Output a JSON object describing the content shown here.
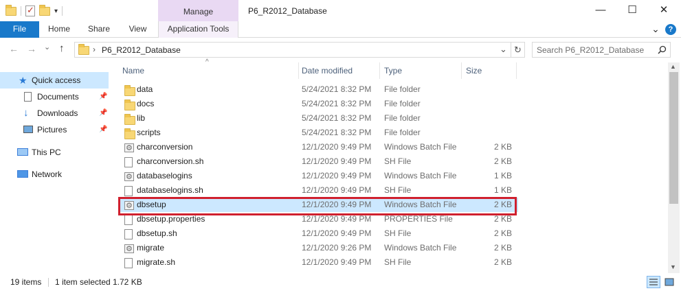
{
  "window": {
    "title": "P6_R2012_Database",
    "minimize": "—",
    "maximize": "☐",
    "close": "✕"
  },
  "ribbon": {
    "context_label": "Manage",
    "tabs": [
      "File",
      "Home",
      "Share",
      "View",
      "Application Tools"
    ],
    "collapse": "⌄",
    "help": "?"
  },
  "address": {
    "back": "←",
    "forward": "→",
    "history": "⌄",
    "up": "↑",
    "separator": "›",
    "path": "P6_R2012_Database",
    "dropdown": "⌄",
    "refresh": "↻"
  },
  "search": {
    "placeholder": "Search P6_R2012_Database",
    "icon": "search-icon"
  },
  "nav": {
    "quick_access": "Quick access",
    "documents": "Documents",
    "downloads": "Downloads",
    "pictures": "Pictures",
    "this_pc": "This PC",
    "network": "Network",
    "pin": "📌"
  },
  "columns": {
    "name": "Name",
    "date": "Date modified",
    "type": "Type",
    "size": "Size",
    "sort_indicator": "^"
  },
  "files": [
    {
      "name": "data",
      "date": "5/24/2021 8:32 PM",
      "type": "File folder",
      "size": "",
      "icon": "folder-icon"
    },
    {
      "name": "docs",
      "date": "5/24/2021 8:32 PM",
      "type": "File folder",
      "size": "",
      "icon": "folder-icon"
    },
    {
      "name": "lib",
      "date": "5/24/2021 8:32 PM",
      "type": "File folder",
      "size": "",
      "icon": "folder-icon"
    },
    {
      "name": "scripts",
      "date": "5/24/2021 8:32 PM",
      "type": "File folder",
      "size": "",
      "icon": "folder-icon"
    },
    {
      "name": "charconversion",
      "date": "12/1/2020 9:49 PM",
      "type": "Windows Batch File",
      "size": "2 KB",
      "icon": "batch-file-icon"
    },
    {
      "name": "charconversion.sh",
      "date": "12/1/2020 9:49 PM",
      "type": "SH File",
      "size": "2 KB",
      "icon": "file-icon"
    },
    {
      "name": "databaselogins",
      "date": "12/1/2020 9:49 PM",
      "type": "Windows Batch File",
      "size": "1 KB",
      "icon": "batch-file-icon"
    },
    {
      "name": "databaselogins.sh",
      "date": "12/1/2020 9:49 PM",
      "type": "SH File",
      "size": "1 KB",
      "icon": "file-icon"
    },
    {
      "name": "dbsetup",
      "date": "12/1/2020 9:49 PM",
      "type": "Windows Batch File",
      "size": "2 KB",
      "icon": "batch-file-icon",
      "selected": true
    },
    {
      "name": "dbsetup.properties",
      "date": "12/1/2020 9:49 PM",
      "type": "PROPERTIES File",
      "size": "2 KB",
      "icon": "file-icon"
    },
    {
      "name": "dbsetup.sh",
      "date": "12/1/2020 9:49 PM",
      "type": "SH File",
      "size": "2 KB",
      "icon": "file-icon"
    },
    {
      "name": "migrate",
      "date": "12/1/2020 9:26 PM",
      "type": "Windows Batch File",
      "size": "2 KB",
      "icon": "batch-file-icon"
    },
    {
      "name": "migrate.sh",
      "date": "12/1/2020 9:49 PM",
      "type": "SH File",
      "size": "2 KB",
      "icon": "file-icon"
    }
  ],
  "status": {
    "item_count": "19 items",
    "selection": "1 item selected",
    "selection_size": "1.72 KB"
  },
  "colors": {
    "accent": "#1979ca",
    "selection": "#cce8ff",
    "highlight_border": "#d0202e",
    "context_tab": "#e9d9f3"
  }
}
